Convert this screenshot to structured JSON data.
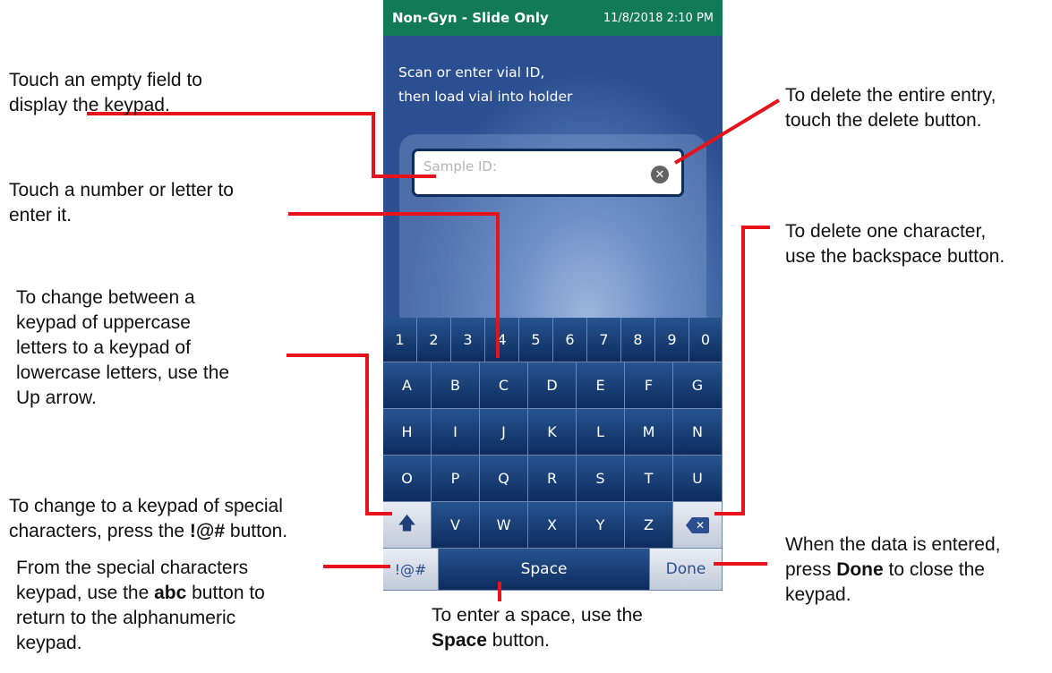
{
  "device": {
    "header": {
      "mode": "Non-Gyn - Slide Only",
      "datetime": "11/8/2018 2:10 PM"
    },
    "instruction": {
      "line1": "Scan or enter vial ID,",
      "line2": "then load vial into holder"
    },
    "sample_field": {
      "placeholder": "Sample ID:",
      "clear_icon": "close-circle-icon"
    },
    "keypad": {
      "numbers": [
        "1",
        "2",
        "3",
        "4",
        "5",
        "6",
        "7",
        "8",
        "9",
        "0"
      ],
      "row1": [
        "A",
        "B",
        "C",
        "D",
        "E",
        "F",
        "G"
      ],
      "row2": [
        "H",
        "I",
        "J",
        "K",
        "L",
        "M",
        "N"
      ],
      "row3": [
        "O",
        "P",
        "Q",
        "R",
        "S",
        "T",
        "U"
      ],
      "row4": [
        "V",
        "W",
        "X",
        "Y",
        "Z"
      ],
      "shift_icon": "up-arrow-icon",
      "backspace_icon": "backspace-icon",
      "special_label": "!@#",
      "space_label": "Space",
      "done_label": "Done"
    }
  },
  "annotations": {
    "empty_field": [
      "Touch an empty field to",
      "display the keypad."
    ],
    "number_letter": [
      "Touch a number or letter to",
      "enter it."
    ],
    "case_change": [
      "To change between a",
      "keypad of uppercase",
      "letters to a keypad of",
      "lowercase letters, use the",
      "Up arrow."
    ],
    "special_chars": {
      "line1": "To change to a keypad of special",
      "line2_pre": "characters, press the ",
      "line2_bold": "!@#",
      "line2_post": " button."
    },
    "abc": {
      "line1": "From the special characters",
      "line2_pre": "keypad, use the ",
      "line2_bold": "abc",
      "line2_post": " button to",
      "line3": "return to the alphanumeric",
      "line4": "keypad."
    },
    "delete_entry": [
      "To delete the entire entry,",
      "touch the delete button."
    ],
    "delete_char": [
      "To delete one character,",
      "use the backspace button."
    ],
    "done": {
      "line1": "When the data is entered,",
      "line2_pre": "press ",
      "line2_bold": "Done",
      "line2_post": " to close the",
      "line3": "keypad."
    },
    "space": {
      "line1": "To enter a space, use the",
      "line2_bold": "Space",
      "line2_post": " button."
    }
  },
  "colors": {
    "callout_line": "#e8121b",
    "header_green": "#137a57",
    "screen_blue": "#2b4f90",
    "key_navy": "#0d2c5e"
  }
}
